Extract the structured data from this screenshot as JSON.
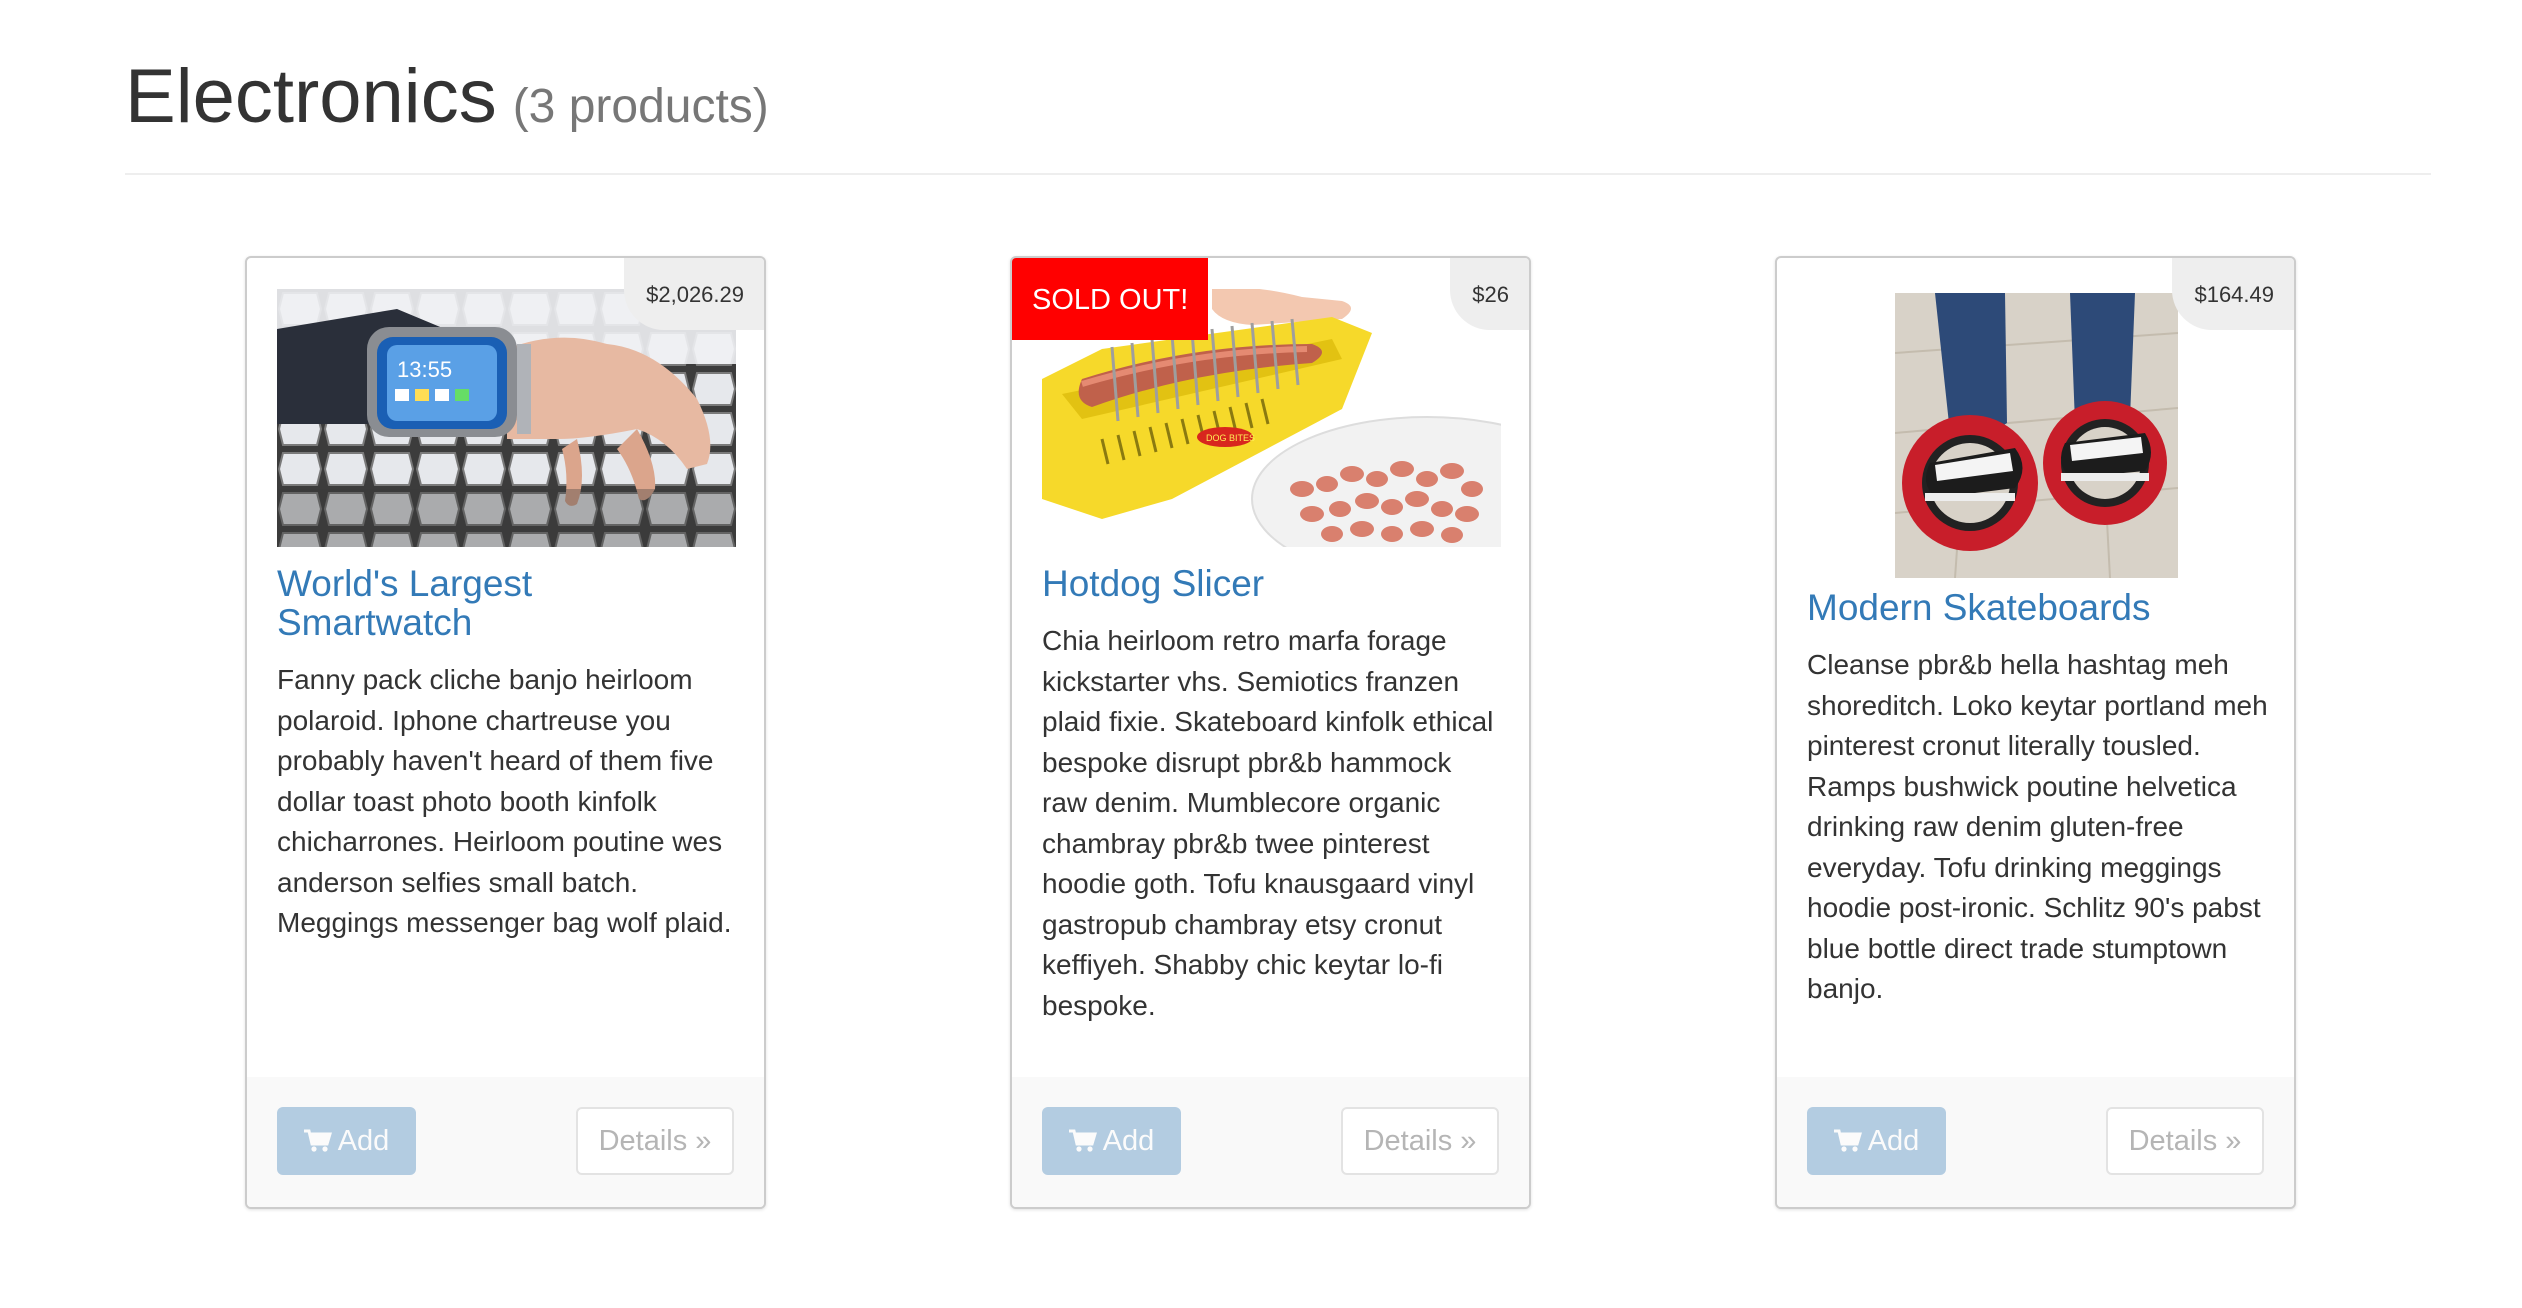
{
  "category": {
    "title": "Electronics",
    "count_label": "(3 products)"
  },
  "products": [
    {
      "name": "World's Largest Smartwatch",
      "price": "$2,026.29",
      "sold_out": false,
      "description": "Fanny pack cliche banjo heirloom polaroid. Iphone chartreuse you probably haven't heard of them five dollar toast photo booth kinfolk chicharrones. Heirloom poutine wes anderson selfies small batch. Meggings messenger bag wolf plaid.",
      "add_label": "Add",
      "details_label": "Details »",
      "image_icon": "smartwatch-photo",
      "watch_time": "13:55"
    },
    {
      "name": "Hotdog Slicer",
      "price": "$26",
      "sold_out": true,
      "sold_out_label": "SOLD OUT!",
      "description": "Chia heirloom retro marfa forage kickstarter vhs. Semiotics franzen plaid fixie. Skateboard kinfolk ethical bespoke disrupt pbr&b hammock raw denim. Mumblecore organic chambray pbr&b twee pinterest hoodie goth. Tofu knausgaard vinyl gastropub chambray etsy cronut keffiyeh. Shabby chic keytar lo-fi bespoke.",
      "add_label": "Add",
      "details_label": "Details »",
      "image_icon": "hotdog-slicer-photo",
      "product_label": "DOG BITES"
    },
    {
      "name": "Modern Skateboards",
      "price": "$164.49",
      "sold_out": false,
      "description": "Cleanse pbr&b hella hashtag meh shoreditch. Loko keytar portland meh pinterest cronut literally tousled. Ramps bushwick poutine helvetica drinking raw denim gluten-free everyday. Tofu drinking meggings hoodie post-ironic. Schlitz 90's pabst blue bottle direct trade stumptown banjo.",
      "add_label": "Add",
      "details_label": "Details »",
      "image_icon": "ring-skates-photo"
    }
  ],
  "colors": {
    "link": "#337ab7",
    "sold_out_bg": "#ff0000",
    "price_badge_bg": "#eeeeee",
    "footer_bg": "#f9f9f9"
  }
}
